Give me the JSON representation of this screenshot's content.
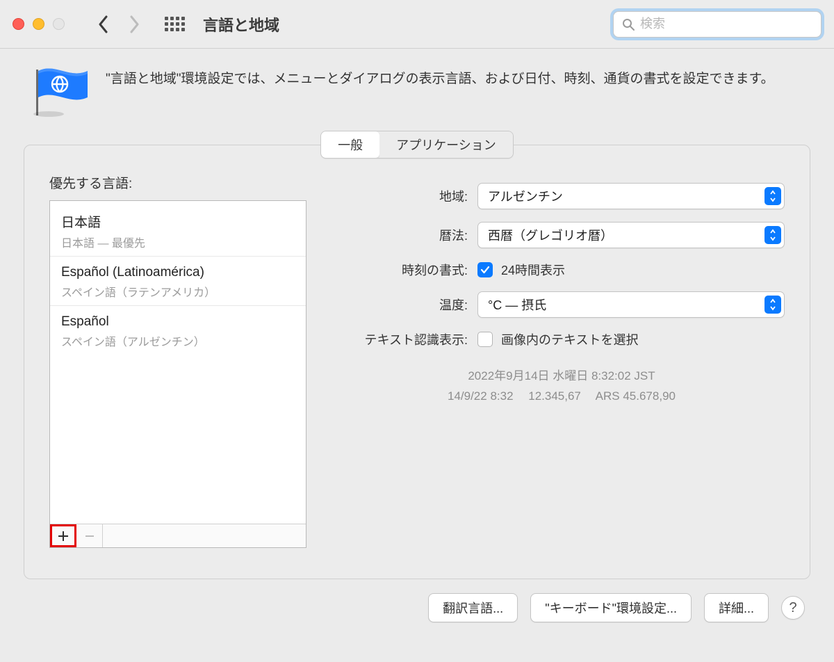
{
  "toolbar": {
    "title": "言語と地域",
    "search_placeholder": "検索"
  },
  "header": {
    "description": "\"言語と地域\"環境設定では、メニューとダイアログの表示言語、および日付、時刻、通貨の書式を設定できます。"
  },
  "tabs": {
    "general": "一般",
    "applications": "アプリケーション"
  },
  "left": {
    "section_label": "優先する言語:",
    "items": [
      {
        "name": "日本語",
        "sub": "日本語 — 最優先"
      },
      {
        "name": "Español (Latinoamérica)",
        "sub": "スペイン語（ラテンアメリカ）"
      },
      {
        "name": "Español",
        "sub": "スペイン語（アルゼンチン）"
      }
    ]
  },
  "right": {
    "region_label": "地域:",
    "region_value": "アルゼンチン",
    "calendar_label": "暦法:",
    "calendar_value": "西暦（グレゴリオ暦）",
    "time_format_label": "時刻の書式:",
    "time_format_check_label": "24時間表示",
    "temperature_label": "温度:",
    "temperature_value": "°C — 摂氏",
    "text_recognition_label": "テキスト認識表示:",
    "text_recognition_check_label": "画像内のテキストを選択",
    "example_line1": "2022年9月14日 水曜日 8:32:02 JST",
    "example_line2": "14/9/22 8:32  12.345,67  ARS 45.678,90"
  },
  "bottom": {
    "translate": "翻訳言語...",
    "keyboard": "\"キーボード\"環境設定...",
    "details": "詳細..."
  }
}
